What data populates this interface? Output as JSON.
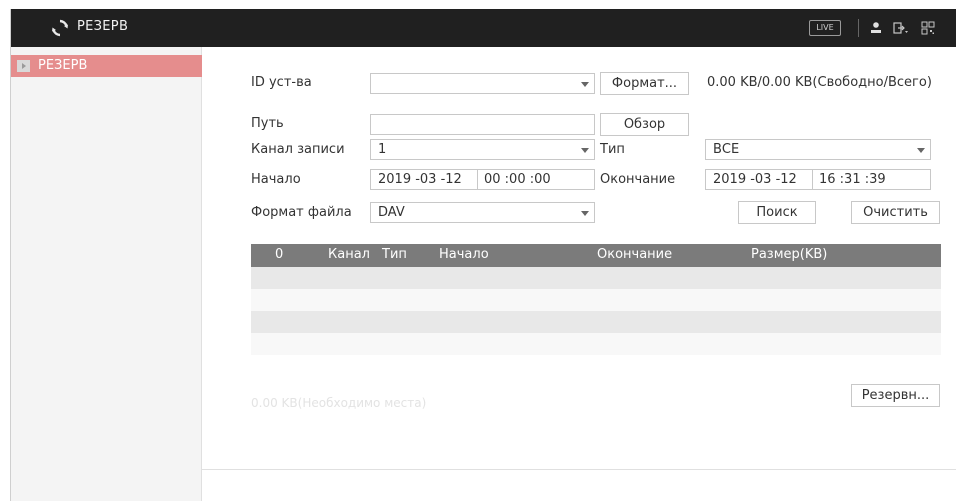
{
  "header": {
    "title": "РЕЗЕРВ",
    "live_label": "LIVE",
    "icons": [
      "refresh-icon",
      "user-icon",
      "logout-icon",
      "qr-code-icon"
    ]
  },
  "sidebar": {
    "items": [
      {
        "label": "РЕЗЕРВ",
        "selected": true
      }
    ]
  },
  "form": {
    "device": {
      "label": "ID уст-ва",
      "value": ""
    },
    "format_button": "Формат...",
    "capacity": "0.00 KB/0.00 KB(Свободно/Всего)",
    "path": {
      "label": "Путь",
      "value": ""
    },
    "browse_button": "Обзор",
    "channel": {
      "label": "Канал записи",
      "value": "1"
    },
    "type": {
      "label": "Тип",
      "value": "ВСЕ"
    },
    "start": {
      "label": "Начало",
      "date": "2019 -03 -12",
      "time": "00 :00 :00"
    },
    "end": {
      "label": "Окончание",
      "date": "2019 -03 -12",
      "time": "16 :31 :39"
    },
    "file_format": {
      "label": "Формат файла",
      "value": "DAV"
    },
    "search_button": "Поиск",
    "clear_button": "Очистить"
  },
  "table": {
    "columns": [
      "0",
      "Канал",
      "Тип",
      "Начало",
      "Окончание",
      "Размер(KB)"
    ],
    "rows": []
  },
  "footer": {
    "required_space": "0.00 KB(Необходимо места)",
    "backup_button": "Резервн..."
  },
  "colors": {
    "header_bg": "#202020",
    "sidebar_selected": "#e58d8d",
    "table_header": "#7b7b7b"
  }
}
